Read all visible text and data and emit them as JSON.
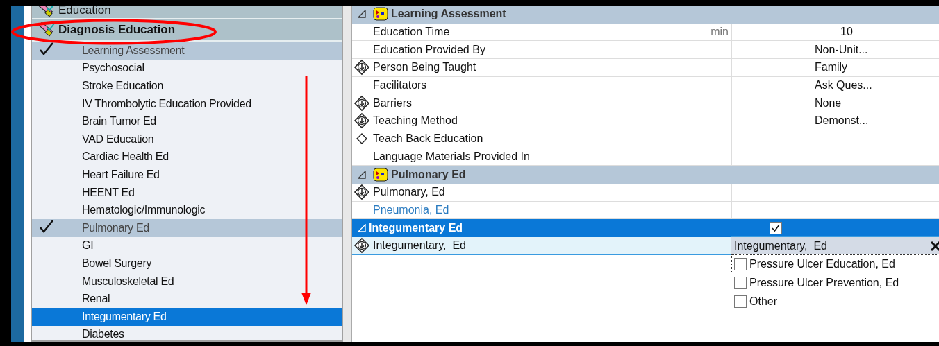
{
  "sidebar": {
    "groups": [
      {
        "label": "Education"
      },
      {
        "label": "Diagnosis Education"
      }
    ],
    "items": [
      {
        "label": "Learning Assessment",
        "done": true,
        "selected": false
      },
      {
        "label": "Psychosocial",
        "done": false,
        "selected": false
      },
      {
        "label": "Stroke Education",
        "done": false,
        "selected": false
      },
      {
        "label": "IV Thrombolytic Education Provided",
        "done": false,
        "selected": false
      },
      {
        "label": "Brain Tumor Ed",
        "done": false,
        "selected": false
      },
      {
        "label": "VAD Education",
        "done": false,
        "selected": false
      },
      {
        "label": "Cardiac Health Ed",
        "done": false,
        "selected": false
      },
      {
        "label": "Heart Failure Ed",
        "done": false,
        "selected": false
      },
      {
        "label": "HEENT Ed",
        "done": false,
        "selected": false
      },
      {
        "label": "Hematologic/Immunologic",
        "done": false,
        "selected": false
      },
      {
        "label": "Pulmonary Ed",
        "done": true,
        "selected": false
      },
      {
        "label": "GI",
        "done": false,
        "selected": false
      },
      {
        "label": "Bowel Surgery",
        "done": false,
        "selected": false
      },
      {
        "label": "Musculoskeletal Ed",
        "done": false,
        "selected": false
      },
      {
        "label": "Renal",
        "done": false,
        "selected": false
      },
      {
        "label": "Integumentary Ed",
        "done": false,
        "selected": true
      },
      {
        "label": "Diabetes",
        "done": false,
        "selected": false
      }
    ]
  },
  "grid": {
    "rows": [
      {
        "kind": "section",
        "label": "Learning Assessment",
        "selected": false,
        "checked": false
      },
      {
        "kind": "item",
        "label": "Education Time",
        "unit": "min",
        "value": "10",
        "selected": false,
        "link": false
      },
      {
        "kind": "item",
        "label": "Education Provided By",
        "value": "Non-Unit...",
        "selected": false,
        "link": false
      },
      {
        "kind": "required",
        "label": "Person Being Taught",
        "value": "Family",
        "selected": false,
        "link": false
      },
      {
        "kind": "item",
        "label": "Facilitators",
        "value": "Ask Ques...",
        "selected": false,
        "link": false
      },
      {
        "kind": "required",
        "label": "Barriers",
        "value": "None",
        "selected": false,
        "link": false
      },
      {
        "kind": "required",
        "label": "Teaching Method",
        "value": "Demonst...",
        "selected": false,
        "link": false
      },
      {
        "kind": "optional",
        "label": "Teach Back Education",
        "selected": false,
        "link": false
      },
      {
        "kind": "item",
        "label": "Language Materials Provided In",
        "selected": false,
        "link": false
      },
      {
        "kind": "section",
        "label": "Pulmonary Ed",
        "selected": false,
        "checked": false
      },
      {
        "kind": "required",
        "label": "Pulmonary, Ed",
        "selected": false,
        "link": false
      },
      {
        "kind": "item",
        "label": "Pneumonia, Ed",
        "selected": false,
        "link": true
      },
      {
        "kind": "section",
        "label": "Integumentary Ed",
        "selected": true,
        "checked": true
      },
      {
        "kind": "required",
        "label": "Integumentary,  Ed",
        "selected": true,
        "link": false
      }
    ]
  },
  "popup": {
    "title": "Integumentary,  Ed",
    "options": [
      {
        "label": "Pressure Ulcer Education, Ed",
        "checked": false,
        "focused": true
      },
      {
        "label": "Pressure Ulcer Prevention, Ed",
        "checked": false,
        "focused": false
      },
      {
        "label": "Other",
        "checked": false,
        "focused": false
      }
    ]
  }
}
